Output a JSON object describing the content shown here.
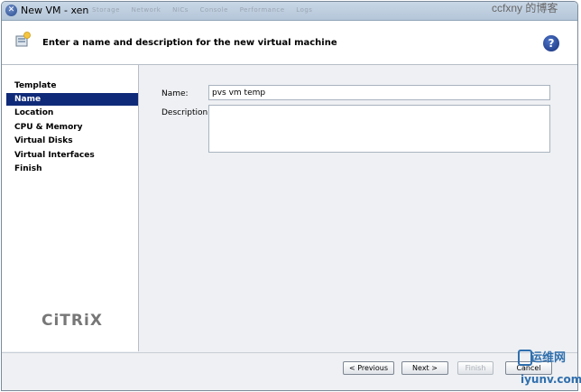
{
  "window": {
    "title": "New VM - xen",
    "faded_menu": [
      "Storage",
      "Network",
      "NICs",
      "Console",
      "Performance",
      "Logs"
    ]
  },
  "header": {
    "title": "Enter a name and description for the new virtual machine"
  },
  "sidebar": {
    "items": [
      {
        "label": "Template"
      },
      {
        "label": "Name"
      },
      {
        "label": "Location"
      },
      {
        "label": "CPU & Memory"
      },
      {
        "label": "Virtual Disks"
      },
      {
        "label": "Virtual Interfaces"
      },
      {
        "label": "Finish"
      }
    ],
    "active_index": 1,
    "logo": "CiTRiX"
  },
  "form": {
    "name_label": "Name:",
    "name_value": "pvs vm temp",
    "description_label": "Description:",
    "description_value": ""
  },
  "footer": {
    "previous_label": "< Previous",
    "next_label": "Next >",
    "finish_label": "Finish",
    "cancel_label": "Cancel"
  },
  "watermarks": {
    "top": "ccfxny 的博客",
    "bottom_cn": "运维网",
    "bottom_url": "iyunv.com"
  },
  "colors": {
    "active_item": "#0f2a78",
    "help_icon": "#1f3d8f",
    "watermark": "#2f6fae"
  },
  "icons": {
    "title": "xen-app-icon",
    "header": "new-vm-icon",
    "help": "help-icon"
  }
}
